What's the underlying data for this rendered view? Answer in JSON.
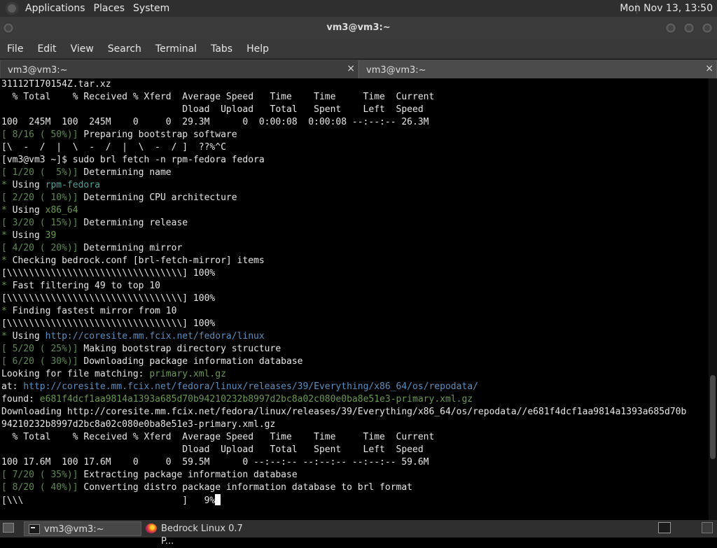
{
  "top_panel": {
    "menus": [
      "Applications",
      "Places",
      "System"
    ],
    "clock": "Mon Nov 13, 13:50"
  },
  "window": {
    "title": "vm3@vm3:~"
  },
  "menubar": [
    "File",
    "Edit",
    "View",
    "Search",
    "Terminal",
    "Tabs",
    "Help"
  ],
  "tabs": [
    {
      "label": "vm3@vm3:~",
      "close": "×"
    },
    {
      "label": "vm3@vm3:~",
      "close": "×"
    }
  ],
  "terminal": {
    "lines": [
      [
        {
          "t": "31112T170154Z.tar.xz"
        }
      ],
      [
        {
          "t": "  % Total    % Received % Xferd  Average Speed   Time    Time     Time  Current"
        }
      ],
      [
        {
          "t": "                                 Dload  Upload   Total   Spent    Left  Speed"
        }
      ],
      [
        {
          "t": "100  245M  100  245M    0     0  29.3M      0  0:00:08  0:00:08 --:--:-- 26.3M"
        }
      ],
      [
        {
          "t": "[ 8/16 ( 50%)]",
          "c": "dim"
        },
        {
          "t": " Preparing bootstrap software"
        }
      ],
      [
        {
          "t": "[\\  -  /  |  \\  -  /  |  \\  -  / ]  ??%^C"
        }
      ],
      [
        {
          "t": "[vm3@vm3 ~]$ sudo brl fetch -n rpm-fedora fedora"
        }
      ],
      [
        {
          "t": "[ 1/20 (  5%)]",
          "c": "dim"
        },
        {
          "t": " Determining name"
        }
      ],
      [
        {
          "t": "*",
          "c": "gr"
        },
        {
          "t": " Using "
        },
        {
          "t": "rpm-fedora",
          "c": "tl"
        }
      ],
      [
        {
          "t": "[ 2/20 ( 10%)]",
          "c": "dim"
        },
        {
          "t": " Determining CPU architecture"
        }
      ],
      [
        {
          "t": "*",
          "c": "gr"
        },
        {
          "t": " Using "
        },
        {
          "t": "x86_64",
          "c": "gr"
        }
      ],
      [
        {
          "t": "[ 3/20 ( 15%)]",
          "c": "dim"
        },
        {
          "t": " Determining release"
        }
      ],
      [
        {
          "t": "*",
          "c": "gr"
        },
        {
          "t": " Using "
        },
        {
          "t": "39",
          "c": "gr"
        }
      ],
      [
        {
          "t": "[ 4/20 ( 20%)]",
          "c": "dim"
        },
        {
          "t": " Determining mirror"
        }
      ],
      [
        {
          "t": "*",
          "c": "gr"
        },
        {
          "t": " Checking bedrock.conf [brl-fetch-mirror] items"
        }
      ],
      [
        {
          "t": "[\\\\\\\\\\\\\\\\\\\\\\\\\\\\\\\\\\\\\\\\\\\\\\\\\\\\\\\\\\\\\\\\] 100%"
        }
      ],
      [
        {
          "t": "*",
          "c": "gr"
        },
        {
          "t": " Fast filtering 49 to top 10"
        }
      ],
      [
        {
          "t": "[\\\\\\\\\\\\\\\\\\\\\\\\\\\\\\\\\\\\\\\\\\\\\\\\\\\\\\\\\\\\\\\\] 100%"
        }
      ],
      [
        {
          "t": "*",
          "c": "gr"
        },
        {
          "t": " Finding fastest mirror from 10"
        }
      ],
      [
        {
          "t": "[\\\\\\\\\\\\\\\\\\\\\\\\\\\\\\\\\\\\\\\\\\\\\\\\\\\\\\\\\\\\\\\\] 100%"
        }
      ],
      [
        {
          "t": "*",
          "c": "gr"
        },
        {
          "t": " Using "
        },
        {
          "t": "http://coresite.mm.fcix.net/fedora/linux",
          "c": "bl"
        }
      ],
      [
        {
          "t": "[ 5/20 ( 25%)]",
          "c": "dim"
        },
        {
          "t": " Making bootstrap directory structure"
        }
      ],
      [
        {
          "t": "[ 6/20 ( 30%)]",
          "c": "dim"
        },
        {
          "t": " Downloading package information database"
        }
      ],
      [
        {
          "t": "Looking for file matching: "
        },
        {
          "t": "primary.xml.gz",
          "c": "gr"
        }
      ],
      [
        {
          "t": "at: "
        },
        {
          "t": "http://coresite.mm.fcix.net/fedora/linux/releases/39/Everything/x86_64/os/repodata/",
          "c": "bl"
        }
      ],
      [
        {
          "t": "found: "
        },
        {
          "t": "e681f4dcf1aa9814a1393a685d70b94210232b8997d2bc8a02c080e0ba8e51e3-primary.xml.gz",
          "c": "gr"
        }
      ],
      [
        {
          "t": "Downloading http://coresite.mm.fcix.net/fedora/linux/releases/39/Everything/x86_64/os/repodata//e681f4dcf1aa9814a1393a685d70b"
        }
      ],
      [
        {
          "t": "94210232b8997d2bc8a02c080e0ba8e51e3-primary.xml.gz"
        }
      ],
      [
        {
          "t": "  % Total    % Received % Xferd  Average Speed   Time    Time     Time  Current"
        }
      ],
      [
        {
          "t": "                                 Dload  Upload   Total   Spent    Left  Speed"
        }
      ],
      [
        {
          "t": "100 17.6M  100 17.6M    0     0  59.5M      0 --:--:-- --:--:-- --:--:-- 59.6M"
        }
      ],
      [
        {
          "t": "[ 7/20 ( 35%)]",
          "c": "dim"
        },
        {
          "t": " Extracting package information database"
        }
      ],
      [
        {
          "t": "[ 8/20 ( 40%)]",
          "c": "dim"
        },
        {
          "t": " Converting distro package information database to brl format"
        }
      ],
      [
        {
          "t": "[\\\\\\                             ]   9%"
        },
        {
          "cursor": true
        }
      ]
    ]
  },
  "scrollbar": {
    "position_fraction": 0.83
  },
  "taskbar": [
    {
      "label": "vm3@vm3:~",
      "icon": "terminal-icon",
      "active": true
    },
    {
      "label": "Bedrock Linux 0.7 P...",
      "icon": "firefox-icon",
      "active": false
    }
  ]
}
